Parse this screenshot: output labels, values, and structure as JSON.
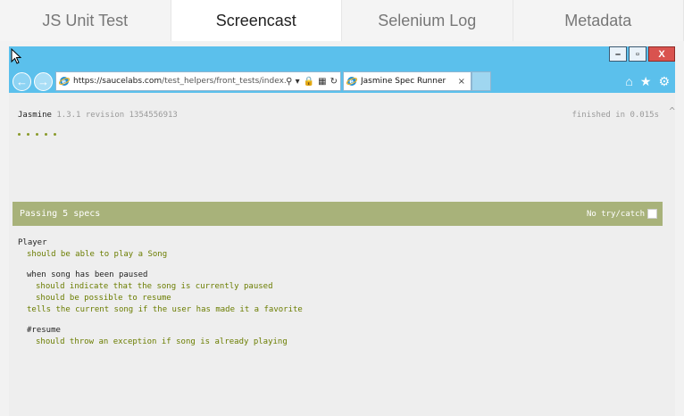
{
  "tabs": [
    {
      "label": "JS Unit Test"
    },
    {
      "label": "Screencast"
    },
    {
      "label": "Selenium Log"
    },
    {
      "label": "Metadata"
    }
  ],
  "window_buttons": {
    "minimize": "–",
    "restore": "▫",
    "close": "X"
  },
  "browser": {
    "url_host": "https://saucelabs.com",
    "url_path": "/test_helpers/front_tests/index.html",
    "tab_title": "Jasmine Spec Runner",
    "tab_close": "×",
    "addr_tools": [
      "⚲ ▾",
      "🔒",
      "▦",
      "↻"
    ]
  },
  "page": {
    "framework": "Jasmine",
    "version": "1.3.1 revision 1354556913",
    "finished": "finished in 0.015s",
    "dot_count": 5,
    "passing": "Passing 5 specs",
    "try_catch": "No try/catch",
    "suite_player": "Player",
    "spec_play": "should be able to play a Song",
    "suite_paused": "when song has been paused",
    "spec_paused": "should indicate that the song is currently paused",
    "spec_resume": "should be possible to resume",
    "spec_favorite": "tells the current song if the user has made it a favorite",
    "suite_resume": "#resume",
    "spec_exception": "should throw an exception if song is already playing"
  },
  "colors": {
    "ie_chrome": "#5bc0ec",
    "pass_bar": "#a8b27a",
    "spec_text": "#6b7d00"
  }
}
